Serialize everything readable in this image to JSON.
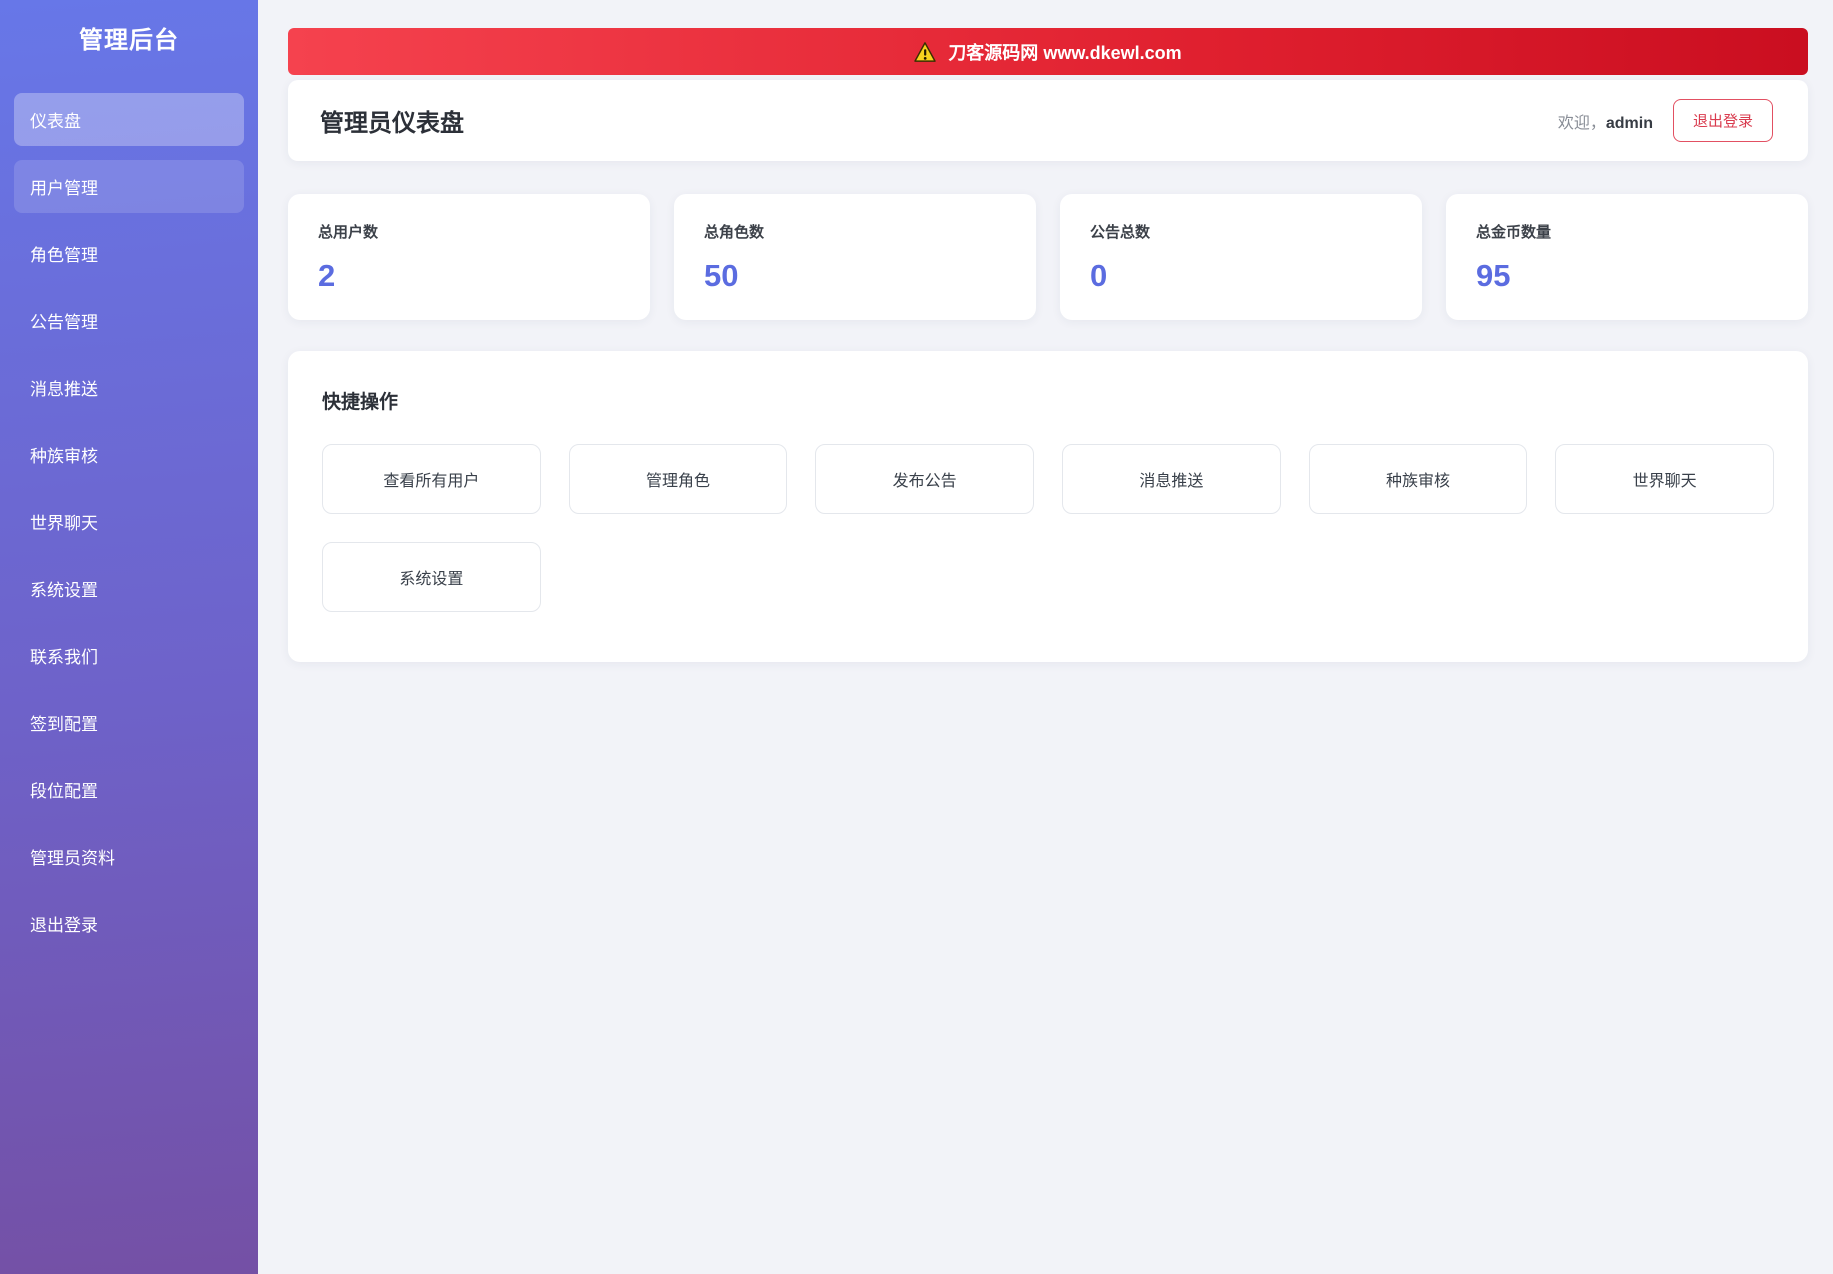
{
  "sidebar": {
    "title": "管理后台",
    "items": [
      {
        "label": "仪表盘"
      },
      {
        "label": "用户管理"
      },
      {
        "label": "角色管理"
      },
      {
        "label": "公告管理"
      },
      {
        "label": "消息推送"
      },
      {
        "label": "种族审核"
      },
      {
        "label": "世界聊天"
      },
      {
        "label": "系统设置"
      },
      {
        "label": "联系我们"
      },
      {
        "label": "签到配置"
      },
      {
        "label": "段位配置"
      },
      {
        "label": "管理员资料"
      },
      {
        "label": "退出登录"
      }
    ]
  },
  "banner": {
    "icon": "warning-icon",
    "text": "刀客源码网 www.dkewl.com"
  },
  "header": {
    "title": "管理员仪表盘",
    "welcome_prefix": "欢迎，",
    "username": "admin",
    "logout_label": "退出登录"
  },
  "stats": [
    {
      "label": "总用户数",
      "value": "2"
    },
    {
      "label": "总角色数",
      "value": "50"
    },
    {
      "label": "公告总数",
      "value": "0"
    },
    {
      "label": "总金币数量",
      "value": "95"
    }
  ],
  "quick_actions": {
    "title": "快捷操作",
    "buttons": [
      {
        "label": "查看所有用户"
      },
      {
        "label": "管理角色"
      },
      {
        "label": "发布公告"
      },
      {
        "label": "消息推送"
      },
      {
        "label": "种族审核"
      },
      {
        "label": "世界聊天"
      },
      {
        "label": "系统设置"
      }
    ]
  },
  "colors": {
    "accent_indigo": "#5b6ce0",
    "danger_red": "#d93b4e",
    "banner_red_left": "#f5424e",
    "banner_red_right": "#ca0e20",
    "sidebar_gradient_top": "#6777e8",
    "sidebar_gradient_bottom": "#7450a5",
    "page_background": "#f2f3f8"
  }
}
